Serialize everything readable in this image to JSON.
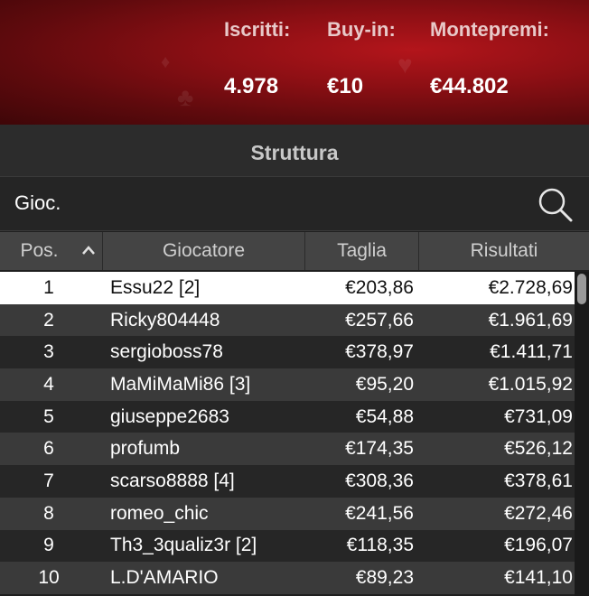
{
  "header": {
    "stats": [
      {
        "label": "Iscritti:",
        "value": "4.978"
      },
      {
        "label": "Buy-in:",
        "value": "€10"
      },
      {
        "label": "Montepremi:",
        "value": "€44.802"
      }
    ]
  },
  "tab": {
    "title": "Struttura"
  },
  "search": {
    "placeholder": "Gioc.",
    "icon": "search-icon"
  },
  "table": {
    "columns": [
      "Pos.",
      "Giocatore",
      "Taglia",
      "Risultati"
    ],
    "sort_icon": "chevron-up-icon",
    "rows": [
      {
        "pos": "1",
        "player": "Essu22 [2]",
        "bounty": "€203,86",
        "result": "€2.728,69"
      },
      {
        "pos": "2",
        "player": "Ricky804448",
        "bounty": "€257,66",
        "result": "€1.961,69"
      },
      {
        "pos": "3",
        "player": "sergioboss78",
        "bounty": "€378,97",
        "result": "€1.411,71"
      },
      {
        "pos": "4",
        "player": "MaMiMaMi86 [3]",
        "bounty": "€95,20",
        "result": "€1.015,92"
      },
      {
        "pos": "5",
        "player": "giuseppe2683",
        "bounty": "€54,88",
        "result": "€731,09"
      },
      {
        "pos": "6",
        "player": "profumb",
        "bounty": "€174,35",
        "result": "€526,12"
      },
      {
        "pos": "7",
        "player": "scarso8888 [4]",
        "bounty": "€308,36",
        "result": "€378,61"
      },
      {
        "pos": "8",
        "player": "romeo_chic",
        "bounty": "€241,56",
        "result": "€272,46"
      },
      {
        "pos": "9",
        "player": "Th3_3qualiz3r [2]",
        "bounty": "€118,35",
        "result": "€196,07"
      },
      {
        "pos": "10",
        "player": "L.D'AMARIO",
        "bounty": "€89,23",
        "result": "€141,10"
      }
    ]
  }
}
